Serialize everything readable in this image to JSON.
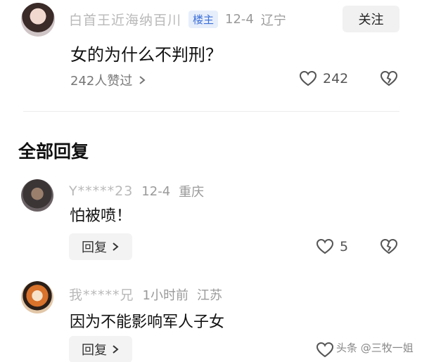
{
  "post": {
    "author_name": "白首王近海纳百川",
    "role_badge": "楼主",
    "date": "12-4",
    "location": "辽宁",
    "follow_label": "关注",
    "text": "女的为什么不判刑？",
    "likes_summary": "242人赞过",
    "like_count": "242"
  },
  "section_title": "全部回复",
  "comments": [
    {
      "author_name": "Y*****23",
      "date": "12-4",
      "location": "重庆",
      "text": "怕被喷！",
      "reply_label": "回复",
      "like_count": "5"
    },
    {
      "author_name": "我*****兄",
      "time": "1小时前",
      "location": "江苏",
      "text": "因为不能影响军人子女",
      "reply_label": "回复"
    }
  ],
  "watermark": "头条 @三牧一姐",
  "icons": [
    "heart-icon",
    "broken-heart-icon",
    "chevron-right-icon"
  ]
}
